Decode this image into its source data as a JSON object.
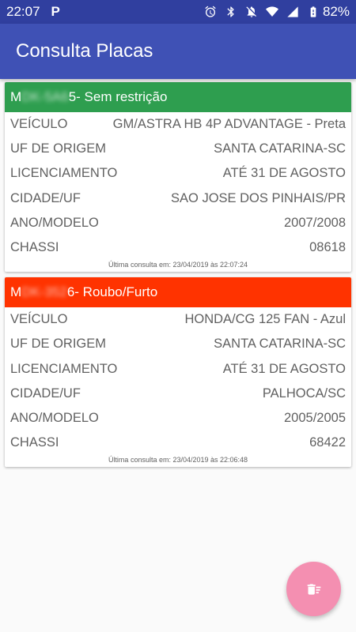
{
  "status_bar": {
    "time": "22:07",
    "parking_glyph": "P",
    "battery": "82%",
    "icons": [
      "alarm-icon",
      "bluetooth-icon",
      "mute-icon",
      "wifi-icon",
      "signal-icon",
      "battery-icon"
    ]
  },
  "app_bar": {
    "title": "Consulta Placas"
  },
  "colors": {
    "primary": "#3f51b5",
    "primary_dark": "#303f9f",
    "ok": "#2e9e4f",
    "alert": "#ff3300",
    "fab": "#f48fb1"
  },
  "cards": [
    {
      "plate_first": "M",
      "plate_hidden": "DK-5A6",
      "plate_last": "5",
      "status": " - Sem restrição",
      "header_color": "#2e9e4f",
      "rows": [
        {
          "label": "VEÍCULO",
          "value": "GM/ASTRA HB 4P ADVANTAGE - Preta"
        },
        {
          "label": "UF DE ORIGEM",
          "value": "SANTA CATARINA-SC"
        },
        {
          "label": "LICENCIAMENTO",
          "value": "ATÉ 31 DE AGOSTO"
        },
        {
          "label": "CIDADE/UF",
          "value": "SAO JOSE DOS PINHAIS/PR"
        },
        {
          "label": "ANO/MODELO",
          "value": "2007/2008"
        },
        {
          "label": "CHASSI",
          "value": "08618"
        }
      ],
      "footer": "Última consulta em: 23/04/2019 às 22:07:24"
    },
    {
      "plate_first": "M",
      "plate_hidden": "DK-352",
      "plate_last": "6",
      "status": " - Roubo/Furto",
      "header_color": "#ff3300",
      "rows": [
        {
          "label": "VEÍCULO",
          "value": "HONDA/CG 125 FAN - Azul"
        },
        {
          "label": "UF DE ORIGEM",
          "value": "SANTA CATARINA-SC"
        },
        {
          "label": "LICENCIAMENTO",
          "value": "ATÉ 31 DE AGOSTO"
        },
        {
          "label": "CIDADE/UF",
          "value": "PALHOCA/SC"
        },
        {
          "label": "ANO/MODELO",
          "value": "2005/2005"
        },
        {
          "label": "CHASSI",
          "value": "68422"
        }
      ],
      "footer": "Última consulta em: 23/04/2019 às 22:06:48"
    }
  ],
  "fab": {
    "icon": "delete-sweep-icon"
  }
}
